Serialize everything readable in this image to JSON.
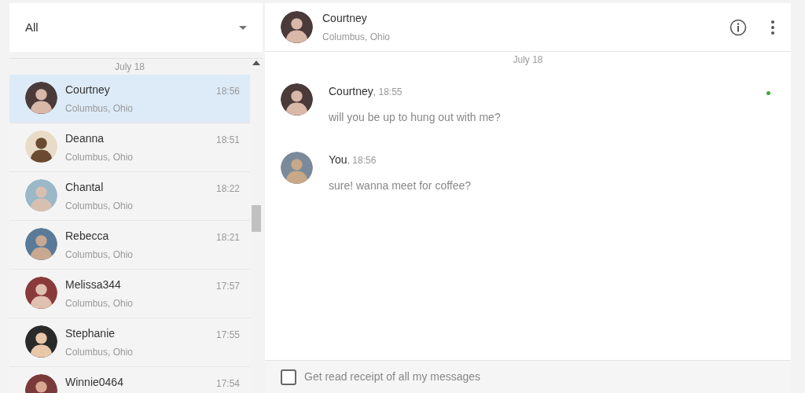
{
  "filter": {
    "value": "All"
  },
  "conversations": {
    "date": "July 18",
    "items": [
      {
        "name": "Courtney",
        "location": "Columbus, Ohio",
        "time": "18:56",
        "selected": true
      },
      {
        "name": "Deanna",
        "location": "Columbus, Ohio",
        "time": "18:51",
        "selected": false
      },
      {
        "name": "Chantal",
        "location": "Columbus, Ohio",
        "time": "18:22",
        "selected": false
      },
      {
        "name": "Rebecca",
        "location": "Columbus, Ohio",
        "time": "18:21",
        "selected": false
      },
      {
        "name": "Melissa344",
        "location": "Columbus, Ohio",
        "time": "17:57",
        "selected": false
      },
      {
        "name": "Stephanie",
        "location": "Columbus, Ohio",
        "time": "17:55",
        "selected": false
      },
      {
        "name": "Winnie0464",
        "time": "17:54",
        "selected": false
      }
    ]
  },
  "chat": {
    "contact": {
      "name": "Courtney",
      "location": "Columbus, Ohio"
    },
    "date": "July 18",
    "messages": [
      {
        "sender": "Courtney",
        "time": ", 18:55",
        "text": "will you be up to hung out with me?",
        "read": true
      },
      {
        "sender": "You",
        "time": ", 18:56",
        "text": "sure! wanna meet for coffee?",
        "read": false
      }
    ],
    "read_receipt": {
      "label": "Get read receipt of all my messages",
      "checked": false
    }
  }
}
